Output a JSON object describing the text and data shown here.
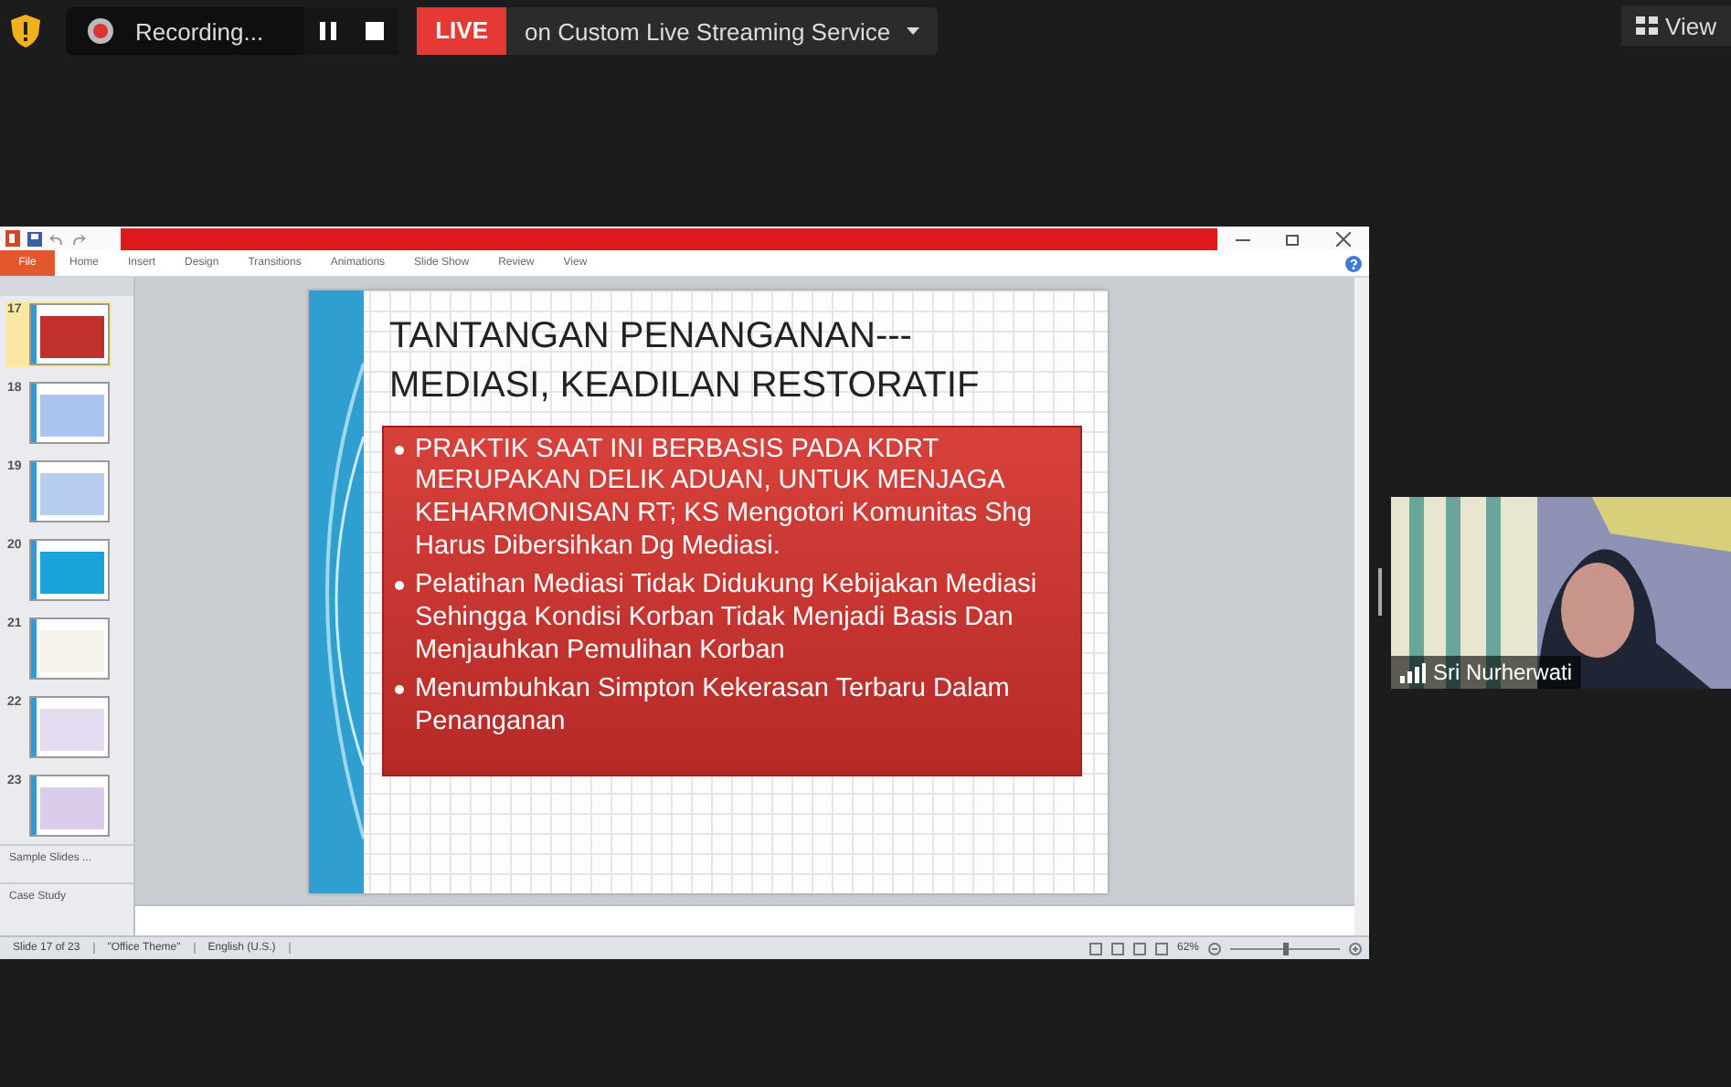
{
  "meeting_bar": {
    "recording": {
      "label": "Recording..."
    },
    "live": {
      "badge": "LIVE",
      "destination": "on Custom Live Streaming Service"
    },
    "view_button": "View"
  },
  "shared_window": {
    "ribbon_tabs": [
      {
        "label": "File",
        "selected": false,
        "kind": "file"
      },
      {
        "label": "Home",
        "selected": false,
        "kind": "tab"
      },
      {
        "label": "Insert",
        "selected": false,
        "kind": "tab"
      },
      {
        "label": "Design",
        "selected": false,
        "kind": "tab"
      },
      {
        "label": "Transitions",
        "selected": false,
        "kind": "tab"
      },
      {
        "label": "Animations",
        "selected": false,
        "kind": "tab"
      },
      {
        "label": "Slide Show",
        "selected": false,
        "kind": "tab"
      },
      {
        "label": "Review",
        "selected": false,
        "kind": "tab"
      },
      {
        "label": "View",
        "selected": false,
        "kind": "tab"
      }
    ],
    "thumbnails": [
      {
        "number": "17",
        "selected": true,
        "color": "#c0302c"
      },
      {
        "number": "18",
        "selected": false,
        "color": "#a9c4ef"
      },
      {
        "number": "19",
        "selected": false,
        "color": "#b7cdf0"
      },
      {
        "number": "20",
        "selected": false,
        "color": "#19a3d8"
      },
      {
        "number": "21",
        "selected": false,
        "color": "#f5f3ea"
      },
      {
        "number": "22",
        "selected": false,
        "color": "#e4dcf0"
      },
      {
        "number": "23",
        "selected": false,
        "color": "#d9cdeb"
      }
    ],
    "sections": [
      "Sample Slides ...",
      "Case Study"
    ],
    "slide": {
      "title": "TANTANGAN PENANGANAN---\nMEDIASI, KEADILAN RESTORATIF",
      "bullets": [
        "PRAKTIK SAAT INI BERBASIS PADA KDRT MERUPAKAN DELIK ADUAN, UNTUK MENJAGA KEHARMONISAN RT; KS Mengotori Komunitas Shg Harus Dibersihkan Dg Mediasi.",
        "Pelatihan Mediasi Tidak Didukung Kebijakan Mediasi Sehingga Kondisi Korban Tidak Menjadi Basis Dan Menjauhkan Pemulihan Korban",
        "Menumbuhkan Simpton Kekerasan Terbaru Dalam Penanganan"
      ]
    },
    "status_bar": {
      "slide_count": "Slide 17 of 23",
      "theme": "\"Office Theme\"",
      "language": "English (U.S.)",
      "zoom": "62%",
      "zoom_slider": {
        "level": 0.5
      }
    }
  },
  "participant": {
    "name": "Sri Nurherwati"
  }
}
